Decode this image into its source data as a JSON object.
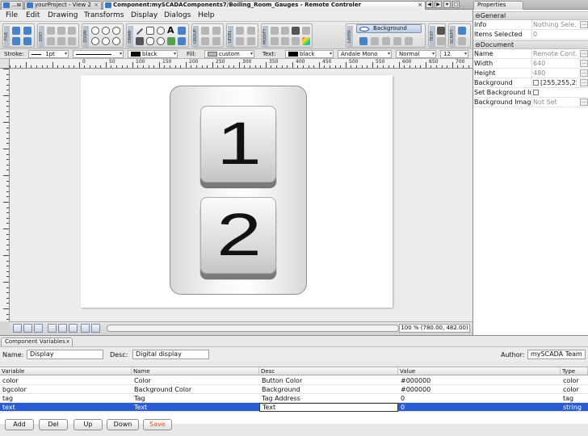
{
  "tabs": [
    {
      "label": "...w",
      "active": false
    },
    {
      "label": "yourProject - View 2",
      "active": false
    },
    {
      "label": "Component:mySCADAComponents7/Boiling_Room_Gauges - Remote Controler",
      "active": true
    }
  ],
  "menu": [
    "File",
    "Edit",
    "Drawing",
    "Transforms",
    "Display",
    "Dialogs",
    "Help"
  ],
  "toolbar": {
    "group_labels": [
      "FILE",
      "EDIT",
      "ZOOM",
      "DRAW",
      "GROUP",
      "LEVEL",
      "MODIFY",
      "LAYER",
      "TEXT",
      "SCRIPT"
    ],
    "layer_value": "Background"
  },
  "strokebar": {
    "stroke_label": "Stroke:",
    "stroke_width": "1pt",
    "stroke_color_name": "black",
    "fill_label": "Fill:",
    "fill_value": "custom",
    "text_label": "Text:",
    "text_color_name": "black",
    "font_family": "Andale Mono",
    "font_style": "Normal",
    "font_size": "12",
    "colors": {
      "black": "#000000",
      "custom": "#b8b8b8"
    }
  },
  "ruler": {
    "marks": [
      "0",
      "50",
      "100",
      "150",
      "200",
      "250",
      "300",
      "350",
      "400",
      "450",
      "500",
      "550",
      "600",
      "650",
      "700",
      "750"
    ]
  },
  "canvas": {
    "buttons": [
      {
        "digit": "1"
      },
      {
        "digit": "2"
      }
    ]
  },
  "status": {
    "zoom_readout": "100 % (780.00, 482.00)"
  },
  "properties": {
    "tab_title": "Properties",
    "sections": [
      {
        "title": "General",
        "rows": [
          {
            "key": "Info",
            "value": "Nothing Sele..."
          },
          {
            "key": "Items Selected",
            "value": "0"
          }
        ]
      },
      {
        "title": "Document",
        "rows": [
          {
            "key": "Name",
            "value": "Remote Cont..."
          },
          {
            "key": "Width",
            "value": "640"
          },
          {
            "key": "Height",
            "value": "480"
          },
          {
            "key": "Background",
            "value": "[255,255,25"
          },
          {
            "key": "Set Background Im",
            "value": ""
          },
          {
            "key": "Background Image",
            "value": "Not Set"
          }
        ]
      }
    ]
  },
  "component_variables": {
    "tab_title": "Component Variables",
    "name_label": "Name:",
    "name_value": "Display",
    "desc_label": "Desc:",
    "desc_value": "Digital display",
    "author_label": "Author:",
    "author_value": "mySCADA Team",
    "columns": [
      "Variable",
      "Name",
      "Desc",
      "Value",
      "Type"
    ],
    "rows": [
      {
        "variable": "color",
        "name": "Color",
        "desc": "Button Color",
        "value": "#000000",
        "type": "color",
        "selected": false
      },
      {
        "variable": "bgcolor",
        "name": "Background Color",
        "desc": "Background",
        "value": "#000000",
        "type": "color",
        "selected": false
      },
      {
        "variable": "tag",
        "name": "Tag",
        "desc": "Tag Address",
        "value": "0",
        "type": "tag",
        "selected": false
      },
      {
        "variable": "text",
        "name": "Text",
        "desc": "Text",
        "value": "0",
        "type": "string",
        "selected": true
      }
    ],
    "buttons": [
      "Add",
      "Del",
      "Up",
      "Down",
      "Save"
    ]
  },
  "colors": {
    "selection": "#2b5bd0",
    "save_text": "#e2561b"
  }
}
